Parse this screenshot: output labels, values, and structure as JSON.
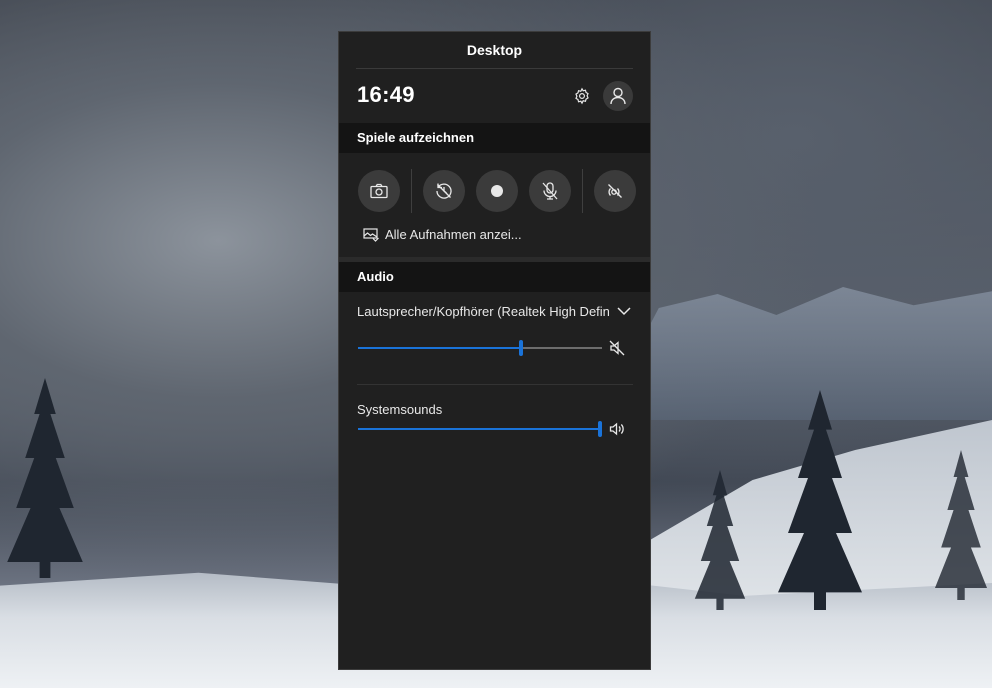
{
  "panel": {
    "title": "Desktop",
    "clock": "16:49",
    "settings_icon": "gear-icon",
    "account_icon": "person-icon"
  },
  "capture": {
    "header": "Spiele aufzeichnen",
    "buttons": [
      {
        "icon": "camera-icon",
        "action": "screenshot"
      },
      {
        "icon": "record-last-icon",
        "action": "record-last-30s"
      },
      {
        "icon": "record-icon",
        "action": "start-recording"
      },
      {
        "icon": "mic-off-icon",
        "action": "toggle-microphone"
      },
      {
        "icon": "broadcast-icon",
        "action": "broadcast"
      }
    ],
    "gallery_link": "Alle Aufnahmen anzei..."
  },
  "audio": {
    "header": "Audio",
    "device": "Lautsprecher/Kopfhörer (Realtek High Definition Audio)",
    "device_volume_percent": 67,
    "device_muted": true,
    "apps": [
      {
        "name": "Systemsounds",
        "volume_percent": 100,
        "muted": false
      }
    ]
  },
  "colors": {
    "panel_bg": "#202020",
    "header_bg": "#141414",
    "accent": "#1a73d9"
  }
}
